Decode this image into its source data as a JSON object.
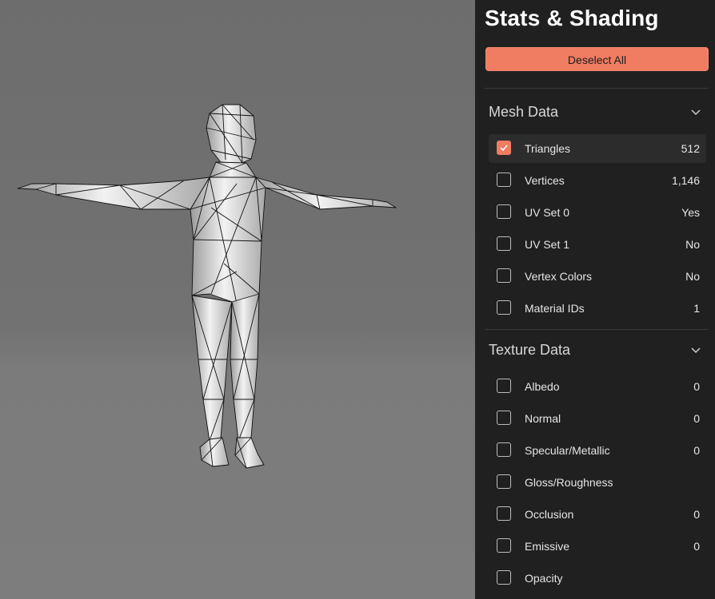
{
  "panel": {
    "title": "Stats & Shading",
    "deselect_label": "Deselect All",
    "accent_color": "#f07c62"
  },
  "mesh": {
    "title": "Mesh Data",
    "items": [
      {
        "label": "Triangles",
        "value": "512",
        "checked": true
      },
      {
        "label": "Vertices",
        "value": "1,146",
        "checked": false
      },
      {
        "label": "UV Set 0",
        "value": "Yes",
        "checked": false
      },
      {
        "label": "UV Set 1",
        "value": "No",
        "checked": false
      },
      {
        "label": "Vertex Colors",
        "value": "No",
        "checked": false
      },
      {
        "label": "Material IDs",
        "value": "1",
        "checked": false
      }
    ]
  },
  "texture": {
    "title": "Texture Data",
    "items": [
      {
        "label": "Albedo",
        "value": "0",
        "checked": false
      },
      {
        "label": "Normal",
        "value": "0",
        "checked": false
      },
      {
        "label": "Specular/Metallic",
        "value": "0",
        "checked": false
      },
      {
        "label": "Gloss/Roughness",
        "value": "",
        "checked": false
      },
      {
        "label": "Occlusion",
        "value": "0",
        "checked": false
      },
      {
        "label": "Emissive",
        "value": "0",
        "checked": false
      },
      {
        "label": "Opacity",
        "value": "",
        "checked": false
      }
    ]
  }
}
